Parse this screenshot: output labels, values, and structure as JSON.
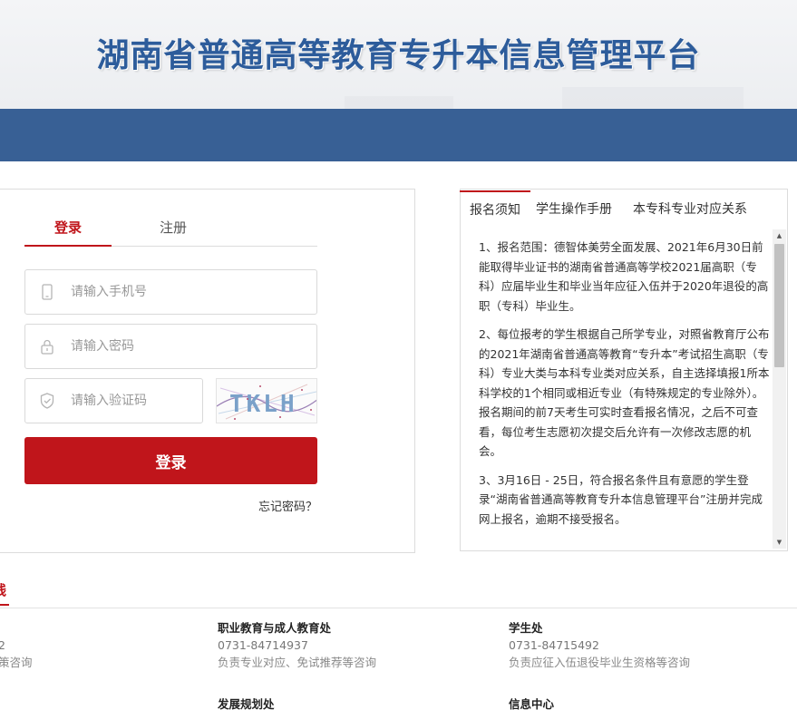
{
  "header": {
    "title": "湖南省普通高等教育专升本信息管理平台"
  },
  "login": {
    "tabs": {
      "login": "登录",
      "register": "注册"
    },
    "phone_placeholder": "请输入手机号",
    "password_placeholder": "请输入密码",
    "captcha_placeholder": "请输入验证码",
    "captcha_text": "TKLH",
    "submit_label": "登录",
    "forgot_label": "忘记密码？"
  },
  "notice": {
    "tabs": [
      "报名须知",
      "学生操作手册",
      "本专科专业对应关系"
    ],
    "paragraphs": [
      "1、报名范围：德智体美劳全面发展、2021年6月30日前能取得毕业证书的湖南省普通高等学校2021届高职（专科）应届毕业生和毕业当年应征入伍并于2020年退役的高职（专科）毕业生。",
      "2、每位报考的学生根据自己所学专业，对照省教育厅公布的2021年湖南省普通高等教育“专升本”考试招生高职（专科）专业大类与本科专业类对应关系，自主选择填报1所本科学校的1个相同或相近专业（有特殊规定的专业除外）。报名期间的前7天考生可实时查看报名情况，之后不可查看，每位考生志愿初次提交后允许有一次修改志愿的机会。",
      "3、3月16日 - 25日，符合报名条件且有意愿的学生登录“湖南省普通高等教育专升本信息管理平台”注册并完成网上报名，逾期不接受报名。"
    ]
  },
  "contacts": {
    "title_fragment": "线",
    "left_partial": {
      "phone": "2",
      "desc": "策咨询"
    },
    "depts": [
      {
        "name": "职业教育与成人教育处",
        "phone": "0731-84714937",
        "desc": "负责专业对应、免试推荐等咨询"
      },
      {
        "name": "学生处",
        "phone": "0731-84715492",
        "desc": "负责应征入伍退役毕业生资格等咨询"
      },
      {
        "name": "发展规划处"
      },
      {
        "name": "信息中心"
      }
    ]
  },
  "colors": {
    "brand_blue": "#386095",
    "title_blue": "#2d5c9b",
    "accent_red": "#c0151b"
  }
}
